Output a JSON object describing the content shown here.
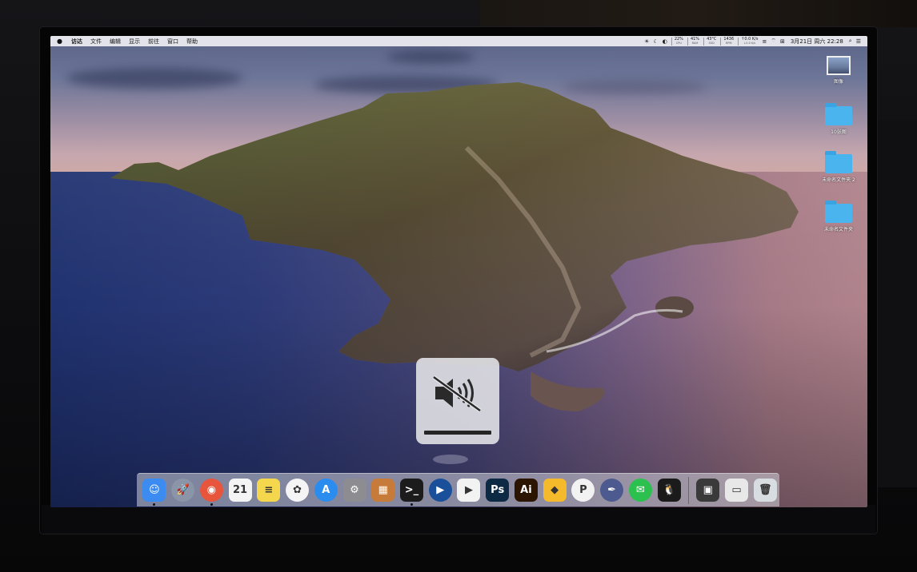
{
  "menubar": {
    "apple_icon": "apple-logo",
    "menus": [
      "访达",
      "文件",
      "编辑",
      "显示",
      "前往",
      "窗口",
      "帮助"
    ],
    "status": {
      "stats": [
        {
          "top": "22%",
          "bottom": "CPU"
        },
        {
          "top": "41%",
          "bottom": "RAM"
        },
        {
          "top": "43°C",
          "bottom": "SSD"
        },
        {
          "top": "1436",
          "bottom": "RPM"
        },
        {
          "top": "↑0.0 K/s",
          "bottom": "↓0.0 K/s"
        }
      ],
      "icons": [
        "brightness-icon",
        "moon-icon",
        "shield-icon",
        "wifi-icon",
        "keyboard-input-icon"
      ],
      "input_label": "⊞",
      "clock": "3月21日 周六  22:28",
      "search_icon": "search-icon",
      "menu_icon": "list-icon"
    }
  },
  "desktop_icons": [
    {
      "label": "图像",
      "type": "image"
    },
    {
      "label": "10张图",
      "type": "folder"
    },
    {
      "label": "未命名文件夹 2",
      "type": "folder"
    },
    {
      "label": "未命名文件夹",
      "type": "folder"
    }
  ],
  "volume_hud": {
    "state": "muted",
    "level": 0
  },
  "dock": {
    "apps": [
      {
        "name": "Finder",
        "glyph": "☺",
        "color": "#3b8bf0",
        "running": true
      },
      {
        "name": "Launchpad",
        "glyph": "🚀",
        "color": "#8a96a8",
        "running": false
      },
      {
        "name": "Siri",
        "glyph": "◉",
        "color": "#e7553d",
        "running": true
      },
      {
        "name": "Calendar",
        "glyph": "21",
        "color": "#f4f4f4",
        "running": false
      },
      {
        "name": "Notes",
        "glyph": "≡",
        "color": "#f4d74c",
        "running": false
      },
      {
        "name": "Photos",
        "glyph": "✿",
        "color": "#f5f5f5",
        "running": false
      },
      {
        "name": "App Store",
        "glyph": "A",
        "color": "#2b8cf0",
        "running": false
      },
      {
        "name": "System Preferences",
        "glyph": "⚙",
        "color": "#8d8d91",
        "running": false
      },
      {
        "name": "Calculator-like",
        "glyph": "▦",
        "color": "#c77b3a",
        "running": false
      },
      {
        "name": "Terminal",
        "glyph": ">_",
        "color": "#1c1c1c",
        "running": true
      },
      {
        "name": "Player",
        "glyph": "▶",
        "color": "#1a4f9a",
        "running": false
      },
      {
        "name": "Youku",
        "glyph": "▶",
        "color": "#f2f2f2",
        "running": false
      },
      {
        "name": "Photoshop",
        "glyph": "Ps",
        "color": "#0c2a44",
        "running": false
      },
      {
        "name": "Illustrator",
        "glyph": "Ai",
        "color": "#2c1500",
        "running": false
      },
      {
        "name": "Sketch",
        "glyph": "◆",
        "color": "#f5b92c",
        "running": false
      },
      {
        "name": "PicGo",
        "glyph": "P",
        "color": "#f2f2f2",
        "running": false
      },
      {
        "name": "Feather",
        "glyph": "✒",
        "color": "#4c5a90",
        "running": false
      },
      {
        "name": "WeChat",
        "glyph": "✉",
        "color": "#2cc04e",
        "running": false
      },
      {
        "name": "QQ",
        "glyph": "🐧",
        "color": "#1b1b1b",
        "running": false
      }
    ],
    "others": [
      {
        "name": "Screenshot",
        "glyph": "▣",
        "color": "#3a3a3a"
      },
      {
        "name": "Preview",
        "glyph": "▭",
        "color": "#e8e8e8"
      },
      {
        "name": "Trash",
        "glyph": "🗑",
        "color": "#d8dde2"
      }
    ]
  },
  "colors": {
    "folder": "#4ab4ef",
    "menubar": "#eeeef2"
  }
}
